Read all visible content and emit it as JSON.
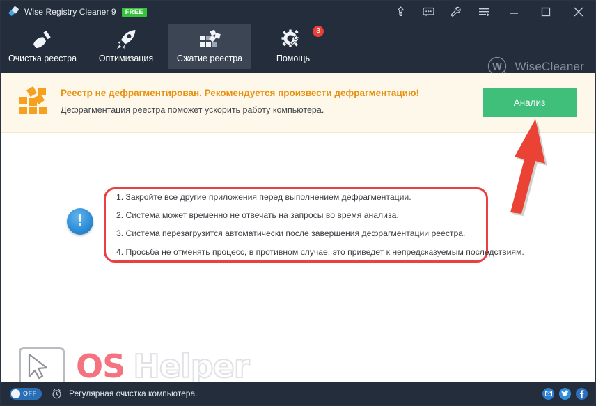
{
  "window": {
    "title": "Wise Registry Cleaner 9",
    "free_badge": "FREE",
    "app_icon": "broom-icon",
    "controls": [
      {
        "name": "upgrade-icon",
        "label": ""
      },
      {
        "name": "feedback-icon",
        "label": ""
      },
      {
        "name": "tools-icon",
        "label": ""
      },
      {
        "name": "menu-icon",
        "label": ""
      },
      {
        "name": "minimize-button",
        "label": ""
      },
      {
        "name": "maximize-button",
        "label": ""
      },
      {
        "name": "close-button",
        "label": ""
      }
    ]
  },
  "nav": {
    "tabs": [
      {
        "label": "Очистка реестра",
        "icon": "broom-icon",
        "active": false,
        "badge": ""
      },
      {
        "label": "Оптимизация",
        "icon": "rocket-icon",
        "active": false,
        "badge": ""
      },
      {
        "label": "Сжатие реестра",
        "icon": "registry-blocks-icon",
        "active": true,
        "badge": ""
      },
      {
        "label": "Помощь",
        "icon": "gear-wrench-icon",
        "active": false,
        "badge": "3"
      }
    ],
    "brand": "WiseCleaner",
    "brand_mark": "w-bubble-icon"
  },
  "banner": {
    "icon": "fragmented-blocks-icon",
    "title": "Реестр не дефрагментирован. Рекомендуется произвести дефрагментацию!",
    "subtitle": "Дефрагментация реестра поможет ускорить работу компьютера.",
    "button_label": "Анализ"
  },
  "main": {
    "info_icon": "exclamation-circle-icon",
    "tips": [
      "1. Закройте все другие приложения перед выполнением дефрагментации.",
      "2. Система может временно не отвечать на запросы во время анализа.",
      "3. Система перезагрузится автоматически после завершения дефрагментации реестра.",
      "4. Просьба не отменять процесс, в противном случае, это приведет к непредсказуемым последствиям."
    ]
  },
  "watermark": {
    "os": "OS",
    "helper": "Helper",
    "icon": "monitor-cursor-icon"
  },
  "status": {
    "toggle_label": "OFF",
    "clock_icon": "alarm-clock-icon",
    "text": "Регулярная очистка компьютера.",
    "socials": [
      {
        "name": "email-icon"
      },
      {
        "name": "twitter-icon"
      },
      {
        "name": "facebook-icon"
      }
    ]
  },
  "annotation": {
    "arrow": "red-pointer-arrow",
    "highlight": "red-rounded-outline"
  },
  "colors": {
    "titlebar": "#242d3c",
    "active_tab": "#3b4554",
    "banner_bg": "#fdf8ea",
    "banner_title": "#e8900f",
    "accent_green": "#3fbf79",
    "badge_red": "#e8403a",
    "annotation_red": "#ec3f41",
    "free_green": "#36c23c",
    "info_blue": "#2f8fd8"
  }
}
